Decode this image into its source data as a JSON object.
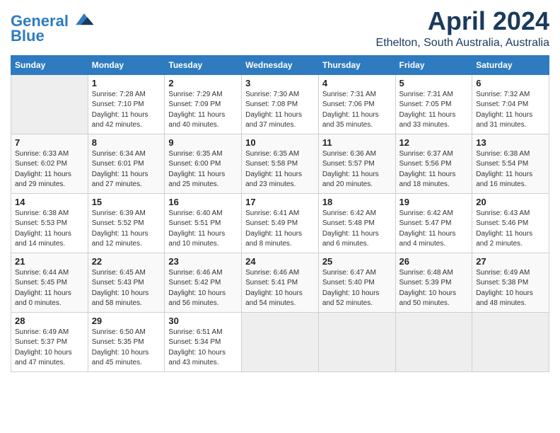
{
  "header": {
    "logo_line1": "General",
    "logo_line2": "Blue",
    "month": "April 2024",
    "location": "Ethelton, South Australia, Australia"
  },
  "weekdays": [
    "Sunday",
    "Monday",
    "Tuesday",
    "Wednesday",
    "Thursday",
    "Friday",
    "Saturday"
  ],
  "weeks": [
    [
      {
        "day": "",
        "sunrise": "",
        "sunset": "",
        "daylight": ""
      },
      {
        "day": "1",
        "sunrise": "Sunrise: 7:28 AM",
        "sunset": "Sunset: 7:10 PM",
        "daylight": "Daylight: 11 hours and 42 minutes."
      },
      {
        "day": "2",
        "sunrise": "Sunrise: 7:29 AM",
        "sunset": "Sunset: 7:09 PM",
        "daylight": "Daylight: 11 hours and 40 minutes."
      },
      {
        "day": "3",
        "sunrise": "Sunrise: 7:30 AM",
        "sunset": "Sunset: 7:08 PM",
        "daylight": "Daylight: 11 hours and 37 minutes."
      },
      {
        "day": "4",
        "sunrise": "Sunrise: 7:31 AM",
        "sunset": "Sunset: 7:06 PM",
        "daylight": "Daylight: 11 hours and 35 minutes."
      },
      {
        "day": "5",
        "sunrise": "Sunrise: 7:31 AM",
        "sunset": "Sunset: 7:05 PM",
        "daylight": "Daylight: 11 hours and 33 minutes."
      },
      {
        "day": "6",
        "sunrise": "Sunrise: 7:32 AM",
        "sunset": "Sunset: 7:04 PM",
        "daylight": "Daylight: 11 hours and 31 minutes."
      }
    ],
    [
      {
        "day": "7",
        "sunrise": "Sunrise: 6:33 AM",
        "sunset": "Sunset: 6:02 PM",
        "daylight": "Daylight: 11 hours and 29 minutes."
      },
      {
        "day": "8",
        "sunrise": "Sunrise: 6:34 AM",
        "sunset": "Sunset: 6:01 PM",
        "daylight": "Daylight: 11 hours and 27 minutes."
      },
      {
        "day": "9",
        "sunrise": "Sunrise: 6:35 AM",
        "sunset": "Sunset: 6:00 PM",
        "daylight": "Daylight: 11 hours and 25 minutes."
      },
      {
        "day": "10",
        "sunrise": "Sunrise: 6:35 AM",
        "sunset": "Sunset: 5:58 PM",
        "daylight": "Daylight: 11 hours and 23 minutes."
      },
      {
        "day": "11",
        "sunrise": "Sunrise: 6:36 AM",
        "sunset": "Sunset: 5:57 PM",
        "daylight": "Daylight: 11 hours and 20 minutes."
      },
      {
        "day": "12",
        "sunrise": "Sunrise: 6:37 AM",
        "sunset": "Sunset: 5:56 PM",
        "daylight": "Daylight: 11 hours and 18 minutes."
      },
      {
        "day": "13",
        "sunrise": "Sunrise: 6:38 AM",
        "sunset": "Sunset: 5:54 PM",
        "daylight": "Daylight: 11 hours and 16 minutes."
      }
    ],
    [
      {
        "day": "14",
        "sunrise": "Sunrise: 6:38 AM",
        "sunset": "Sunset: 5:53 PM",
        "daylight": "Daylight: 11 hours and 14 minutes."
      },
      {
        "day": "15",
        "sunrise": "Sunrise: 6:39 AM",
        "sunset": "Sunset: 5:52 PM",
        "daylight": "Daylight: 11 hours and 12 minutes."
      },
      {
        "day": "16",
        "sunrise": "Sunrise: 6:40 AM",
        "sunset": "Sunset: 5:51 PM",
        "daylight": "Daylight: 11 hours and 10 minutes."
      },
      {
        "day": "17",
        "sunrise": "Sunrise: 6:41 AM",
        "sunset": "Sunset: 5:49 PM",
        "daylight": "Daylight: 11 hours and 8 minutes."
      },
      {
        "day": "18",
        "sunrise": "Sunrise: 6:42 AM",
        "sunset": "Sunset: 5:48 PM",
        "daylight": "Daylight: 11 hours and 6 minutes."
      },
      {
        "day": "19",
        "sunrise": "Sunrise: 6:42 AM",
        "sunset": "Sunset: 5:47 PM",
        "daylight": "Daylight: 11 hours and 4 minutes."
      },
      {
        "day": "20",
        "sunrise": "Sunrise: 6:43 AM",
        "sunset": "Sunset: 5:46 PM",
        "daylight": "Daylight: 11 hours and 2 minutes."
      }
    ],
    [
      {
        "day": "21",
        "sunrise": "Sunrise: 6:44 AM",
        "sunset": "Sunset: 5:45 PM",
        "daylight": "Daylight: 11 hours and 0 minutes."
      },
      {
        "day": "22",
        "sunrise": "Sunrise: 6:45 AM",
        "sunset": "Sunset: 5:43 PM",
        "daylight": "Daylight: 10 hours and 58 minutes."
      },
      {
        "day": "23",
        "sunrise": "Sunrise: 6:46 AM",
        "sunset": "Sunset: 5:42 PM",
        "daylight": "Daylight: 10 hours and 56 minutes."
      },
      {
        "day": "24",
        "sunrise": "Sunrise: 6:46 AM",
        "sunset": "Sunset: 5:41 PM",
        "daylight": "Daylight: 10 hours and 54 minutes."
      },
      {
        "day": "25",
        "sunrise": "Sunrise: 6:47 AM",
        "sunset": "Sunset: 5:40 PM",
        "daylight": "Daylight: 10 hours and 52 minutes."
      },
      {
        "day": "26",
        "sunrise": "Sunrise: 6:48 AM",
        "sunset": "Sunset: 5:39 PM",
        "daylight": "Daylight: 10 hours and 50 minutes."
      },
      {
        "day": "27",
        "sunrise": "Sunrise: 6:49 AM",
        "sunset": "Sunset: 5:38 PM",
        "daylight": "Daylight: 10 hours and 48 minutes."
      }
    ],
    [
      {
        "day": "28",
        "sunrise": "Sunrise: 6:49 AM",
        "sunset": "Sunset: 5:37 PM",
        "daylight": "Daylight: 10 hours and 47 minutes."
      },
      {
        "day": "29",
        "sunrise": "Sunrise: 6:50 AM",
        "sunset": "Sunset: 5:35 PM",
        "daylight": "Daylight: 10 hours and 45 minutes."
      },
      {
        "day": "30",
        "sunrise": "Sunrise: 6:51 AM",
        "sunset": "Sunset: 5:34 PM",
        "daylight": "Daylight: 10 hours and 43 minutes."
      },
      {
        "day": "",
        "sunrise": "",
        "sunset": "",
        "daylight": ""
      },
      {
        "day": "",
        "sunrise": "",
        "sunset": "",
        "daylight": ""
      },
      {
        "day": "",
        "sunrise": "",
        "sunset": "",
        "daylight": ""
      },
      {
        "day": "",
        "sunrise": "",
        "sunset": "",
        "daylight": ""
      }
    ]
  ]
}
